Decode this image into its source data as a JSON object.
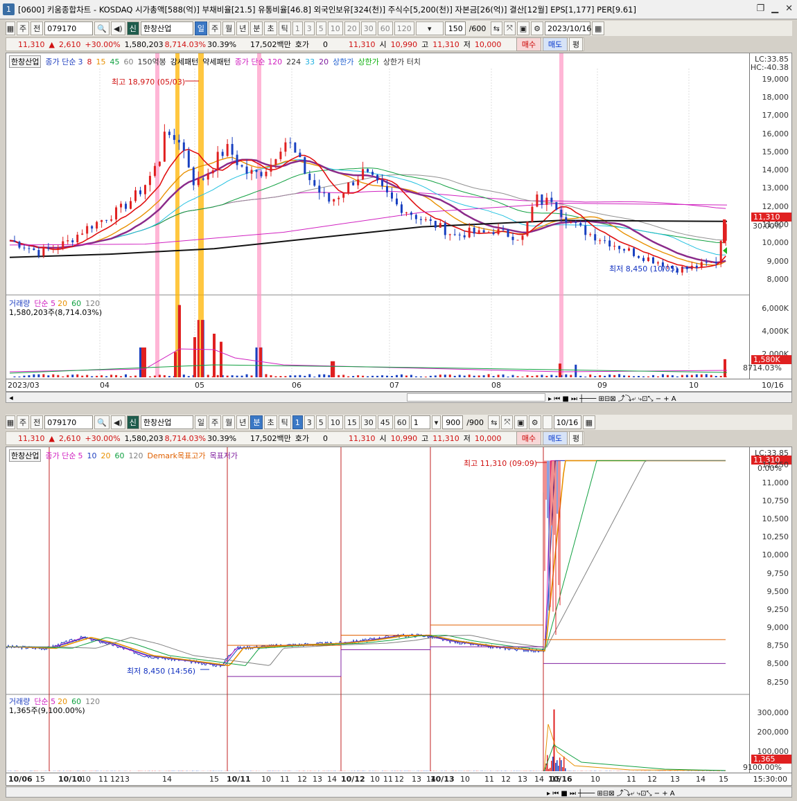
{
  "window": {
    "number": "1",
    "title": "[0600] 키움종합차트 - KOSDAQ 시가총액[588(억)] 부채비율[21.5] 유통비율[46.8] 외국인보유[324(천)] 주식수[5,200(천)] 자본금[26(억)] 결산[12월] EPS[1,177] PER[9.61]"
  },
  "top": {
    "toolbar": {
      "type1": "주",
      "type2": "전",
      "code": "079170",
      "name": "한창산업",
      "periods": [
        "일",
        "주",
        "월",
        "년",
        "분",
        "초",
        "틱"
      ],
      "selected_period": "일",
      "nums": [
        "1",
        "3",
        "5",
        "10",
        "20",
        "30",
        "60",
        "120"
      ],
      "count": "150",
      "total": "/600",
      "date": "2023/10/16"
    },
    "info": {
      "price": "11,310",
      "change": "2,610",
      "change_pct": "+30.00%",
      "volume": "1,580,203",
      "vol_pct": "8,714.03%",
      "turnover": "30.39%",
      "amount": "17,502백만",
      "hoga": "호가",
      "hoga_val": "0",
      "p_cur": "11,310",
      "open_l": "시",
      "open": "10,990",
      "high_l": "고",
      "high": "11,310",
      "low_l": "저",
      "low": "10,000",
      "buy": "매수",
      "sell": "매도",
      "avg": "평"
    },
    "legend": {
      "name": "한창산업",
      "ma": "종가 단순",
      "ma_vals": [
        "3",
        "8",
        "15",
        "45",
        "60"
      ],
      "p150": "150억봉",
      "strong": "강세패턴",
      "weak": "약세패턴",
      "ma2": "종가 단순 120",
      "v224": "224",
      "v33": "33",
      "v20": "20",
      "lim1": "상한가",
      "lim2": "상한가",
      "lim3": "상한가 터치"
    },
    "lc": "LC:33.85",
    "hc": "HC:-40.38",
    "yaxis": [
      "19,000",
      "18,000",
      "17,000",
      "16,000",
      "15,000",
      "14,000",
      "13,000",
      "12,000",
      "11,000",
      "10,000",
      "9,000",
      "8,000"
    ],
    "cur_box": "11,310",
    "cur_pct": "30.00%",
    "high_ann": "최고 18,970 (05/03)",
    "low_ann": "최저 8,450 (10/05)",
    "vol_legend": {
      "name": "거래량",
      "ma": "단순 5",
      "v20": "20",
      "v60": "60",
      "v120": "120",
      "value": "1,580,203주(8,714.03%)"
    },
    "vol_axis": [
      "6,000K",
      "4,000K",
      "2,000K"
    ],
    "vol_box": "1,580K",
    "vol_pct": "8714.03%",
    "xaxis": [
      "2023/03",
      "04",
      "05",
      "06",
      "07",
      "08",
      "09",
      "10",
      "10/16"
    ]
  },
  "bottom": {
    "toolbar": {
      "type1": "주",
      "type2": "전",
      "code": "079170",
      "name": "한창산업",
      "periods": [
        "일",
        "주",
        "월",
        "년",
        "분",
        "초",
        "틱"
      ],
      "selected_period": "분",
      "nums": [
        "1",
        "3",
        "5",
        "10",
        "15",
        "30",
        "45",
        "60"
      ],
      "sel_num": "1",
      "cnt": "1",
      "count": "900",
      "total": "/900",
      "date": "10/16"
    },
    "info": {
      "price": "11,310",
      "change": "2,610",
      "change_pct": "+30.00%",
      "volume": "1,580,203",
      "vol_pct": "8,714.03%",
      "turnover": "30.39%",
      "amount": "17,502백만",
      "hoga": "호가",
      "hoga_val": "0",
      "p_cur": "11,310",
      "open_l": "시",
      "open": "10,990",
      "high_l": "고",
      "high": "11,310",
      "low_l": "저",
      "low": "10,000",
      "buy": "매수",
      "sell": "매도",
      "avg": "평"
    },
    "legend": {
      "name": "한창산업",
      "ma": "종가 단순",
      "ma_vals": [
        "5",
        "10",
        "20",
        "60",
        "120"
      ],
      "dmark_hi": "Demark목표고가",
      "dmark_lo": "목표저가"
    },
    "lc": "LC:33.85",
    "cur_box": "11,310",
    "cur_pct": "0.00%",
    "yaxis": [
      "11,250",
      "11,000",
      "10,750",
      "10,500",
      "10,250",
      "10,000",
      "9,750",
      "9,500",
      "9,250",
      "9,000",
      "8,750",
      "8,500",
      "8,250"
    ],
    "high_ann": "최고 11,310 (09:09)",
    "low_ann": "최저 8,450 (14:56)",
    "vol_legend": {
      "name": "거래량",
      "ma": "단순 5",
      "v20": "20",
      "v60": "60",
      "v120": "120",
      "value": "1,365주(9,100.00%)"
    },
    "vol_axis": [
      "300,000",
      "200,000",
      "100,000"
    ],
    "vol_box": "1,365",
    "vol_pct": "9100.00%",
    "xaxis": [
      "10/06",
      "15",
      "10/10",
      "10",
      "11",
      "1213",
      "14",
      "15",
      "10/11",
      "10",
      "11",
      "12",
      "13",
      "14",
      "10/12",
      "10",
      "11",
      "12",
      "13",
      "14",
      "10/13",
      "10",
      "11",
      "12",
      "13",
      "14",
      "15",
      "10/16",
      "10",
      "11",
      "12",
      "13",
      "14",
      "15"
    ],
    "time": "15:30:00"
  },
  "colors": {
    "up": "#e02020",
    "down": "#1840c0",
    "pink": "#ff9ec8",
    "orange": "#ffb400"
  }
}
